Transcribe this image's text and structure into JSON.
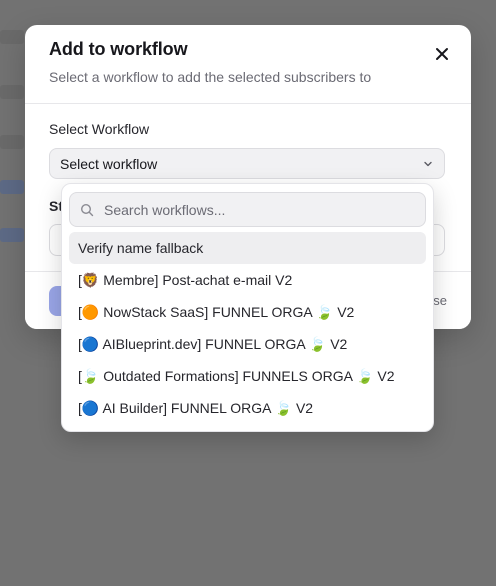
{
  "modal": {
    "title": "Add to workflow",
    "subtitle": "Select a workflow to add the selected subscribers to",
    "field_label": "Select Workflow",
    "select_value": "Select workflow",
    "second_field_label": "St",
    "close_button_text": "se"
  },
  "dropdown": {
    "search_placeholder": "Search workflows...",
    "options": [
      "Verify name fallback",
      "[🦁 Membre] Post-achat e-mail V2",
      "[🟠 NowStack SaaS] FUNNEL ORGA 🍃 V2",
      "[🔵 AIBlueprint.dev] FUNNEL ORGA 🍃 V2",
      "[🍃 Outdated Formations] FUNNELS ORGA 🍃 V2",
      "[🔵 AI Builder] FUNNEL ORGA 🍃 V2"
    ],
    "highlighted_index": 0
  },
  "icons": {
    "close": "close-icon",
    "chevron": "chevron-down-icon",
    "search": "search-icon"
  },
  "colors": {
    "overlay": "#727272",
    "primary_button": "#9aa6e8",
    "highlight": "#eeeef0"
  }
}
